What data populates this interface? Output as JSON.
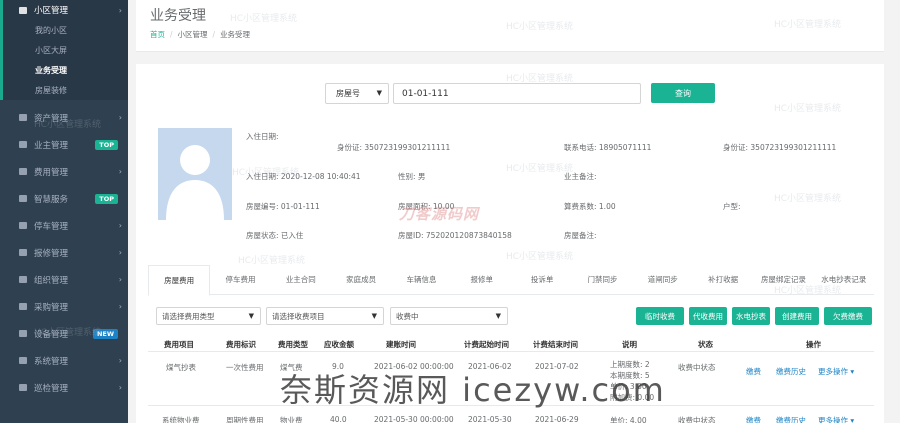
{
  "sidebar": {
    "items": [
      {
        "label": "小区管理",
        "open": true
      },
      {
        "label": "资产管理"
      },
      {
        "label": "业主管理",
        "tag": "TOP",
        "tag_color": "#1ab394"
      },
      {
        "label": "费用管理"
      },
      {
        "label": "智慧服务",
        "tag": "TOP",
        "tag_color": "#1ab394"
      },
      {
        "label": "停车管理"
      },
      {
        "label": "报修管理"
      },
      {
        "label": "组织管理"
      },
      {
        "label": "采购管理"
      },
      {
        "label": "设备管理",
        "tag": "NEW",
        "tag_color": "#1c84c6"
      },
      {
        "label": "系统管理"
      },
      {
        "label": "巡检管理"
      }
    ],
    "subitems": [
      {
        "label": "我的小区"
      },
      {
        "label": "小区大屏"
      },
      {
        "label": "业务受理",
        "active": true
      },
      {
        "label": "房屋装修"
      }
    ]
  },
  "header": {
    "title": "业务受理",
    "crumbs": [
      "首页",
      "小区管理",
      "业务受理"
    ]
  },
  "search": {
    "type": "房屋号",
    "value": "01-01-111",
    "button": "查询"
  },
  "info": {
    "checkin_label": "入住日期:",
    "id1": "身份证:  350723199301211111",
    "phone": "联系电话:  18905071111",
    "id2": "身份证:  350723199301211111",
    "checkin_date": "入住日期:  2020-12-08 10:40:41",
    "gender": "性别:  男",
    "owner_note": "业主备注:",
    "room_no": "房屋编号:  01-01-111",
    "area": "房屋面积:  10.00",
    "coeff": "算费系数:  1.00",
    "house_type": "户型:",
    "room_state": "房屋状态:  已入住",
    "room_id": "房屋ID:  752020120873840158",
    "room_note": "房屋备注:"
  },
  "tabs": [
    "房屋费用",
    "停车费用",
    "业主合同",
    "家庭成员",
    "车辆信息",
    "报修单",
    "投诉单",
    "门禁同步",
    "道闸同步",
    "补打收据",
    "房屋绑定记录",
    "水电抄表记录"
  ],
  "filters": {
    "fee_type": "请选择费用类型",
    "fee_item": "请选择收费项目",
    "status": "收费中"
  },
  "actions": [
    "临时收费",
    "代收费用",
    "水电抄表",
    "创建费用",
    "欠费缴费"
  ],
  "table": {
    "headers": [
      "费用项目",
      "费用标识",
      "费用类型",
      "应收金额",
      "建账时间",
      "计费起始时间",
      "计费结束时间",
      "说明",
      "状态",
      "操作"
    ],
    "rows": [
      {
        "cells": [
          "煤气抄表",
          "一次性费用",
          "煤气费",
          "9.0",
          "2021-06-02 00:00:00",
          "2021-06-02",
          "2021-07-02"
        ],
        "note": [
          "上期度数: 2",
          "本期度数: 5",
          "单价: 3.00",
          "附加费: 0.00"
        ],
        "status": "收费中状态",
        "ops": [
          "缴费",
          "缴费历史",
          "更多操作 ▾"
        ]
      },
      {
        "cells": [
          "系统物业费",
          "周期性费用",
          "物业费",
          "40.0",
          "2021-05-30 00:00:00",
          "2021-05-30",
          "2021-06-29"
        ],
        "note": [
          "单价: 4.00"
        ],
        "status": "收费中状态",
        "ops": [
          "缴费",
          "缴费历史",
          "更多操作 ▾"
        ]
      }
    ]
  },
  "watermarks": {
    "repeat": "HC小区管理系统",
    "brand": "刀客源码网",
    "bottom": "奈斯资源网 icezyw.com"
  }
}
